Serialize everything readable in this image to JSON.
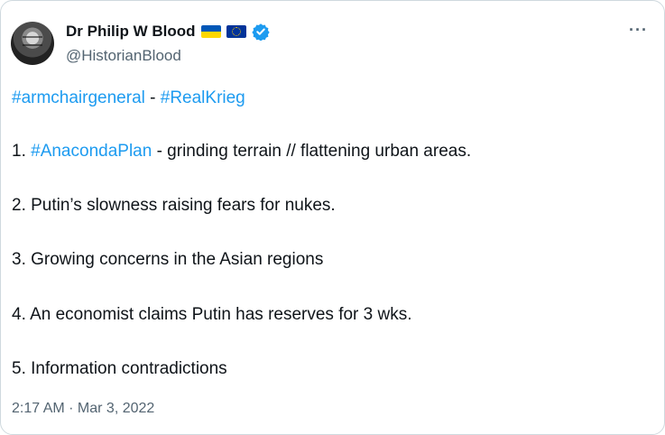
{
  "author": {
    "display_name": "Dr Philip W Blood",
    "handle": "@HistorianBlood",
    "flags": [
      "ukraine-flag-icon",
      "eu-flag-icon"
    ],
    "verified": true
  },
  "more_label": "···",
  "tweet": {
    "line1": {
      "tag1": "#armchairgeneral",
      "sep": " - ",
      "tag2": "#RealKrieg"
    },
    "item1": {
      "prefix": "1. ",
      "tag": "#AnacondaPlan",
      "text": " - grinding terrain // flattening urban areas."
    },
    "item2": "2. Putin’s slowness raising fears for nukes.",
    "item3": "3. Growing concerns in the Asian regions",
    "item4": "4. An economist claims Putin has reserves for 3 wks.",
    "item5": "5. Information contradictions"
  },
  "timestamp": "2:17 AM · Mar 3, 2022",
  "colors": {
    "link": "#1d9bf0",
    "text": "#0f1419",
    "secondary": "#536471",
    "border": "#cfd9de"
  }
}
